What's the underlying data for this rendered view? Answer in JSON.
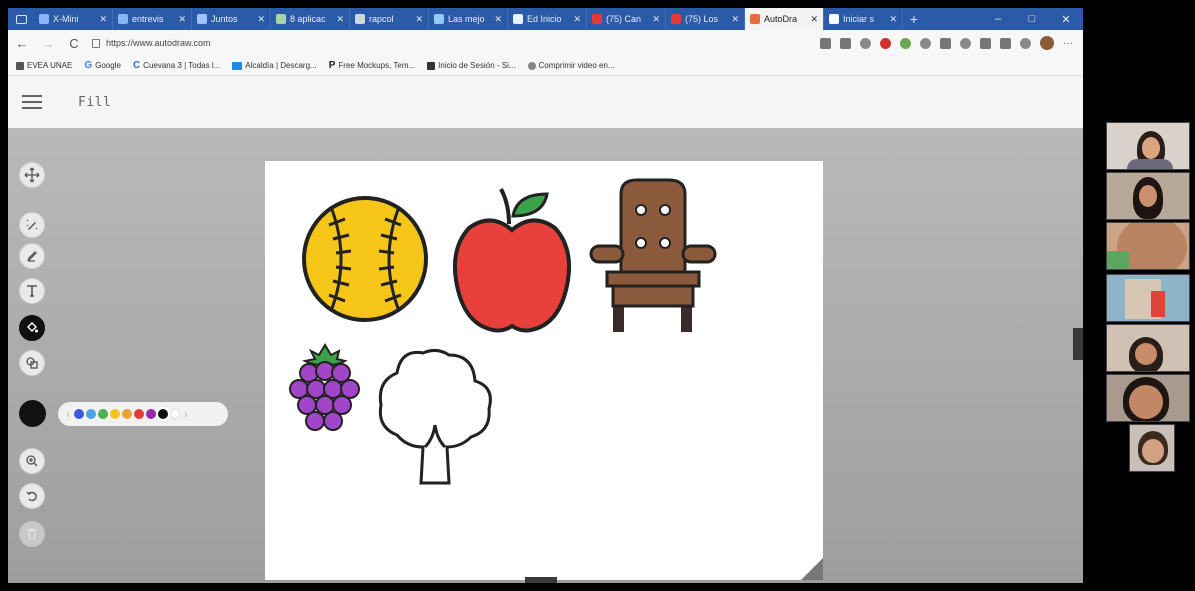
{
  "browser": {
    "tabs": [
      {
        "label": "X-Mini",
        "favicon": "#8ab4f8"
      },
      {
        "label": "entrevis",
        "favicon": "#8ab4f8"
      },
      {
        "label": "Juntos",
        "favicon": "#9fc4ff"
      },
      {
        "label": "8 aplicac",
        "favicon": "#a5d6a7"
      },
      {
        "label": "rapcol",
        "favicon": "#cfd8dc"
      },
      {
        "label": "Las mejo",
        "favicon": "#90caf9"
      },
      {
        "label": "Ed Inicio",
        "favicon": "#e3f2fd"
      },
      {
        "label": "(75) Can",
        "favicon": "#e53935"
      },
      {
        "label": "(75) Los",
        "favicon": "#e53935"
      },
      {
        "label": "AutoDra",
        "favicon": "#e86a3a",
        "active": true
      },
      {
        "label": "Iniciar s",
        "favicon": "#ffffff"
      }
    ],
    "new_tab": "+",
    "window_controls": {
      "minimize": "–",
      "maximize": "□",
      "close": "✕"
    },
    "nav": {
      "back": "←",
      "forward": "→",
      "reload": "C"
    },
    "url": "https://www.autodraw.com",
    "bookmarks": [
      {
        "label": "EVEA UNAE",
        "icon_color": "#555"
      },
      {
        "label": "Google",
        "icon_text": "G",
        "icon_color": "#4285f4"
      },
      {
        "label": "Cuevana 3 | Todas l...",
        "icon_text": "C",
        "icon_color": "#2a6fdb"
      },
      {
        "label": "Alcaldía | Descarg...",
        "icon_color": "#1e88e5"
      },
      {
        "label": "Free Mockups, Tem...",
        "icon_text": "P",
        "icon_color": "#222"
      },
      {
        "label": "Inicio de Sesión - Si...",
        "icon_color": "#333"
      },
      {
        "label": "Comprimir video en...",
        "icon_color": "#888"
      }
    ],
    "extensions_more": "···"
  },
  "app": {
    "title": "Fill"
  },
  "tools": [
    {
      "name": "move-tool",
      "icon": "move-arrows"
    },
    {
      "name": "autodraw-tool",
      "icon": "magic-pencil"
    },
    {
      "name": "draw-tool",
      "icon": "pencil"
    },
    {
      "name": "type-tool",
      "icon": "text-T"
    },
    {
      "name": "fill-tool",
      "icon": "paint-bucket",
      "selected": true
    },
    {
      "name": "shape-tool",
      "icon": "shapes"
    },
    {
      "name": "zoom-tool",
      "icon": "zoom-in"
    },
    {
      "name": "undo-tool",
      "icon": "undo"
    },
    {
      "name": "delete-tool",
      "icon": "trash"
    }
  ],
  "colors": {
    "current": "#111111",
    "palette": [
      "#3a5bd9",
      "#4aa3df",
      "#4caf50",
      "#f5c518",
      "#f0a030",
      "#e53935",
      "#9c27b0",
      "#111111",
      "#ffffff"
    ]
  },
  "drawings": [
    {
      "name": "baseball",
      "fill": "#f5c518"
    },
    {
      "name": "apple",
      "fill": "#e8403a",
      "leaf": "#3aa34a"
    },
    {
      "name": "chair",
      "fill": "#8b5a3c"
    },
    {
      "name": "grapes",
      "fill": "#a045c8",
      "leaf": "#3aa34a"
    },
    {
      "name": "tree",
      "fill": "#ffffff"
    }
  ],
  "video_participants": 7
}
